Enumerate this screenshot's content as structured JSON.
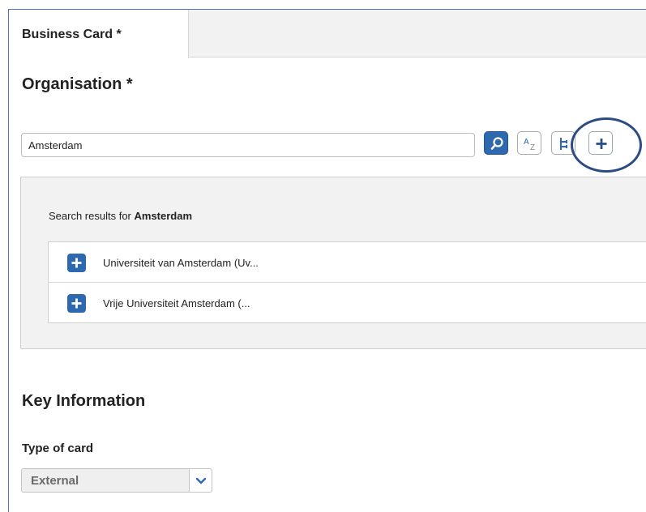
{
  "tabs": [
    {
      "label": "Business Card *",
      "active": true
    }
  ],
  "organisation": {
    "title": "Organisation *",
    "search_value": "Amsterdam",
    "buttons": {
      "search_icon": "magnifier-icon",
      "sort_icon": "sort-az-icon",
      "hierarchy_icon": "hierarchy-tree-icon",
      "add_icon": "plus-icon"
    }
  },
  "results": {
    "prefix": "Search results for ",
    "query": "Amsterdam",
    "items": [
      {
        "label": "Universiteit van Amsterdam (Uv..."
      },
      {
        "label": "Vrije Universiteit Amsterdam (..."
      }
    ]
  },
  "key_information": {
    "title": "Key Information",
    "type_of_card_label": "Type of card",
    "type_of_card_value": "External"
  },
  "colors": {
    "accent": "#2e69b0",
    "highlight": "#2c4c84",
    "frame": "#4e73c4"
  }
}
